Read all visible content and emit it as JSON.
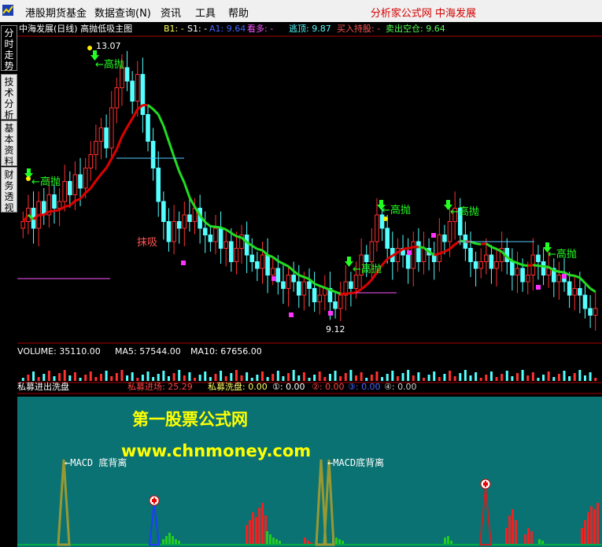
{
  "menu": {
    "items": [
      "港股期货基金",
      "数据查询(N)",
      "资讯",
      "工具",
      "帮助"
    ],
    "right_title": "分析家公式网  中海发展"
  },
  "sidebar": {
    "tabs": [
      "分时走势",
      "技术分析",
      "基本资料",
      "财务透视"
    ],
    "active_tab": "分析"
  },
  "main_header": {
    "title": "中海发展(日线) 高抛低吸主图",
    "b1": "B1: -",
    "s1": "S1: -",
    "a1": "A1: 9.64",
    "kan_duo": "看多: -",
    "tao_ding": "逃顶: 9.87",
    "mai_ru": "买入持股: -",
    "mai_chu": "卖出空仓: 9.64"
  },
  "annotations": {
    "high_price": "13.07",
    "low_price": "9.12",
    "sell_label": "高抛",
    "sell_label_arrow": "←高抛",
    "buy_label": "抹吸"
  },
  "volume_header": {
    "volume": "VOLUME: 35110.00",
    "ma5": "MA5: 57544.00",
    "ma10": "MA10: 67656.00"
  },
  "indicator_header": {
    "name": "私募进出洗盘",
    "enter": "私募进场: 25.29",
    "wash": "私募洗盘: 0.00",
    "v1": "①: 0.00",
    "v2": "②: 0.00",
    "v3": "③: 0.00",
    "v4": "④: 0.00"
  },
  "watermark": {
    "line1": "第一股票公式网",
    "line2": "www.chnmoney.com"
  },
  "macd_labels": {
    "left": "←MACD 底背离",
    "right": "←MACD底背离"
  },
  "colors": {
    "up": "#ff3030",
    "down": "#54ffff",
    "ma_red": "#e00000",
    "ma_green": "#22dd22",
    "panel": "#0a7272",
    "axis": "#aa0000"
  },
  "chart_data": {
    "type": "candlestick",
    "closes": [
      10.6,
      10.8,
      10.5,
      10.9,
      10.7,
      11.0,
      10.8,
      10.9,
      11.2,
      11.0,
      11.3,
      11.1,
      11.4,
      11.6,
      11.8,
      12.0,
      11.7,
      12.3,
      12.6,
      12.9,
      12.7,
      12.4,
      12.8,
      12.2,
      11.8,
      11.4,
      10.9,
      10.6,
      10.3,
      10.6,
      10.5,
      10.7,
      10.6,
      10.8,
      10.5,
      10.4,
      10.3,
      10.5,
      10.2,
      10.3,
      10.0,
      10.2,
      10.4,
      10.1,
      10.0,
      9.9,
      10.1,
      9.8,
      9.9,
      9.7,
      9.6,
      9.8,
      9.7,
      9.5,
      9.7,
      9.6,
      9.4,
      9.5,
      9.6,
      9.4,
      9.3,
      9.5,
      9.7,
      9.6,
      9.8,
      10.1,
      10.0,
      10.3,
      10.7,
      10.5,
      10.2,
      10.0,
      10.2,
      10.1,
      9.9,
      10.3,
      10.0,
      10.2,
      10.1,
      10.0,
      10.4,
      10.3,
      10.6,
      10.8,
      10.4,
      10.2,
      10.0,
      9.9,
      10.0,
      10.1,
      9.9,
      10.0,
      10.2,
      10.0,
      9.8,
      9.9,
      9.7,
      9.8,
      10.1,
      10.0,
      9.8,
      9.9,
      9.7,
      9.8,
      9.7,
      9.5,
      9.6,
      9.5,
      9.3,
      9.2,
      9.3
    ],
    "high": 13.07,
    "low": 9.12
  }
}
